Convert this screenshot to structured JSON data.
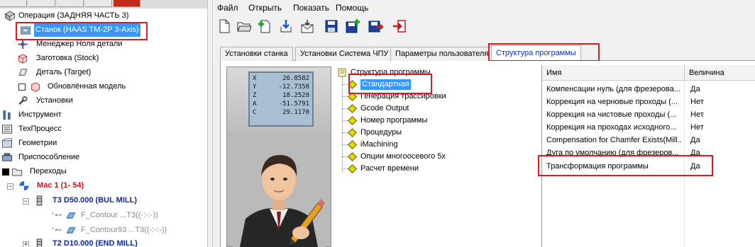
{
  "left_tree": {
    "items": [
      {
        "label": "Операция (ЗАДНЯЯ ЧАСТЬ 3)",
        "icon": "operation-icon"
      },
      {
        "label": "Станок (HAAS TM-2P 3-Axis)",
        "icon": "machine-icon",
        "selected": true
      },
      {
        "label": "Менеджер Ноля детали",
        "icon": "zero-manager-icon"
      },
      {
        "label": "Заготовка (Stock)",
        "icon": "stock-icon"
      },
      {
        "label": "Деталь (Target)",
        "icon": "part-icon"
      },
      {
        "label": "Обновлённая модель",
        "icon": "updated-model-icon"
      },
      {
        "label": "Установки",
        "icon": "wrench-icon"
      },
      {
        "label": "Инструмент",
        "icon": "tool-icon"
      },
      {
        "label": "ТехПроцесс",
        "icon": "process-icon"
      },
      {
        "label": "Геометрии",
        "icon": "geometry-icon"
      },
      {
        "label": "Приспособление",
        "icon": "fixture-icon"
      },
      {
        "label": "Переходы",
        "icon": "folder-icon"
      },
      {
        "label": "Мас 1 (1- 54)",
        "icon": "mac-icon"
      },
      {
        "label": "T3  D50.000  (BUL MILL)",
        "icon": "tool-entry-icon"
      },
      {
        "label": "F_Contour ...T3((-:-:-))",
        "icon": "contour-icon"
      },
      {
        "label": "F_Contour93 ...T3((-:-:-))",
        "icon": "contour-icon"
      },
      {
        "label": "T2  D10.000  (END MILL)",
        "icon": "tool-entry-icon"
      }
    ]
  },
  "menu": {
    "items": [
      "Файл",
      "Открыть",
      "Показать",
      "Помощь"
    ]
  },
  "toolbar": {
    "buttons": [
      "new-file-icon",
      "open-folder-icon",
      "add-document-icon",
      "download-icon",
      "mail-icon",
      "save-icon",
      "save-add-icon",
      "save-export-icon",
      "exit-icon"
    ]
  },
  "tabs": {
    "items": [
      "Установки станка",
      "Установки Система ЧПУ",
      "Параметры пользователя",
      "Структура программы"
    ],
    "active_index": 3
  },
  "dro": {
    "rows": [
      {
        "axis": "X",
        "value": "26.8582"
      },
      {
        "axis": "Y",
        "value": "-12.7358"
      },
      {
        "axis": "Z",
        "value": "18.2528"
      },
      {
        "axis": "A",
        "value": "-51.5791"
      },
      {
        "axis": "C",
        "value": "29.1170"
      }
    ]
  },
  "program_tree": {
    "root": "Структура программы",
    "items": [
      "Стандартная",
      "Генерация трассировки",
      "Gcode Output",
      "Номер программы",
      "Процедуры",
      "iMachining",
      "Опции многоосевого 5x",
      "Расчет времени"
    ],
    "selected_index": 0
  },
  "grid": {
    "col_name": "Имя",
    "col_value": "Величина",
    "rows": [
      {
        "name": "Компенсации нуль (для фрезерова...",
        "value": "Да"
      },
      {
        "name": "Коррекция на черновые проходы (...",
        "value": "Нет"
      },
      {
        "name": "Коррекция на чистовые проходы (...",
        "value": "Нет"
      },
      {
        "name": "Коррекция на проходах исходного...",
        "value": "Нет"
      },
      {
        "name": "Compensation for Chamfer Exists(Mill...",
        "value": "Да"
      },
      {
        "name": "Дуга по умолчанию (для фрезеров...",
        "value": "Да"
      },
      {
        "name": "Трансформация программы",
        "value": "Да"
      }
    ]
  },
  "colors": {
    "highlight": "#3399ff",
    "annotation_red": "#e0191f",
    "active_tab_text": "#0033cc",
    "diamond_yellow": "#e6d800"
  }
}
